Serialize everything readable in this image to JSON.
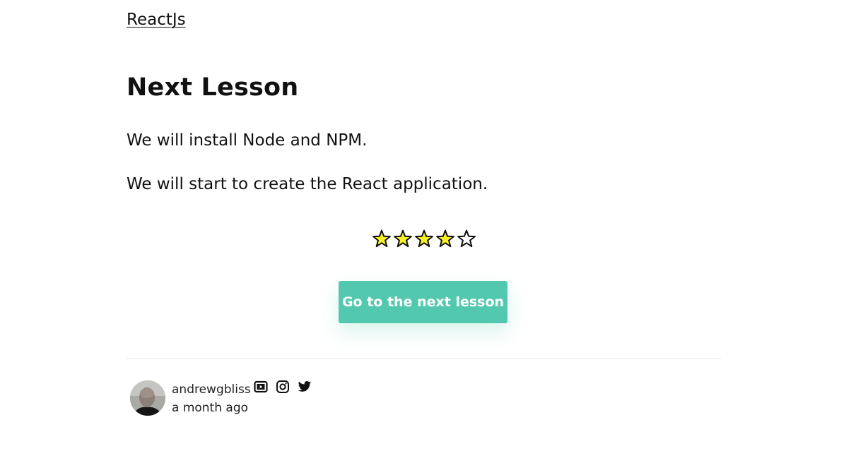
{
  "breadcrumb": {
    "link_label": "ReactJs"
  },
  "lesson": {
    "title": "Next Lesson",
    "paragraphs": [
      "We will install Node and NPM.",
      "We will start to create the React application."
    ]
  },
  "rating": {
    "value": 4,
    "max": 5,
    "filled_color": "#f8f025",
    "empty_color": "#ffffff",
    "outline_color": "#111111"
  },
  "cta": {
    "label": "Go to the next lesson",
    "color": "#52c9ae"
  },
  "author": {
    "name": "andrewgbliss",
    "posted": "a month ago",
    "social_icons": [
      "youtube-icon",
      "instagram-icon",
      "twitter-icon"
    ]
  }
}
